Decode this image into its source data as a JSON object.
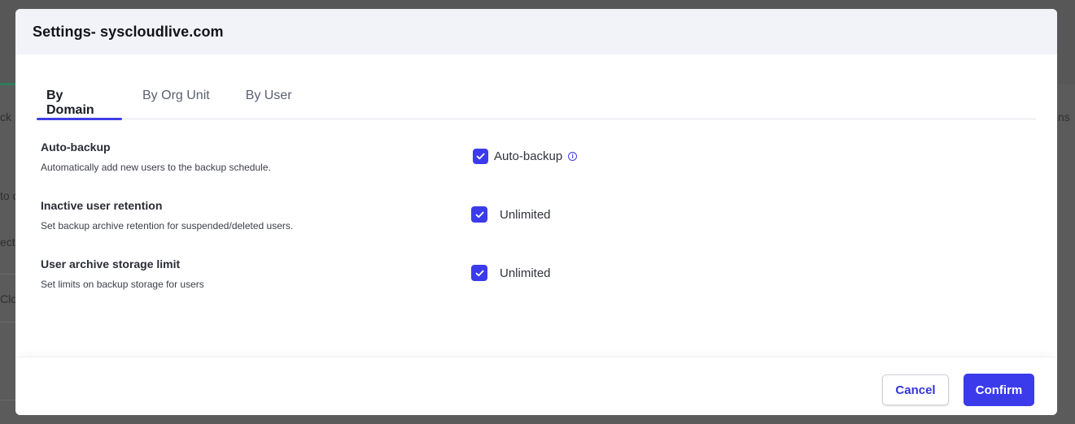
{
  "background": {
    "fragments": [
      "ck",
      "to d",
      "ect",
      "Clo",
      "ns"
    ]
  },
  "modal": {
    "title": "Settings- syscloudlive.com",
    "tabs": [
      {
        "label": "By Domain",
        "active": true
      },
      {
        "label": "By Org Unit",
        "active": false
      },
      {
        "label": "By User",
        "active": false
      }
    ],
    "settings": [
      {
        "title": "Auto-backup",
        "description": "Automatically add new users to the backup schedule.",
        "control_label": "Auto-backup",
        "checked": true,
        "info_icon": "info-icon"
      },
      {
        "title": "Inactive user retention",
        "description": "Set backup archive retention for suspended/deleted users.",
        "control_label": "Unlimited",
        "checked": true
      },
      {
        "title": "User archive storage limit",
        "description": "Set limits on backup storage for users",
        "control_label": "Unlimited",
        "checked": true
      }
    ],
    "footer": {
      "cancel_label": "Cancel",
      "confirm_label": "Confirm"
    }
  },
  "colors": {
    "accent": "#3b3beb",
    "header_bg": "#f1f3f8",
    "overlay": "#5b5b5b"
  }
}
